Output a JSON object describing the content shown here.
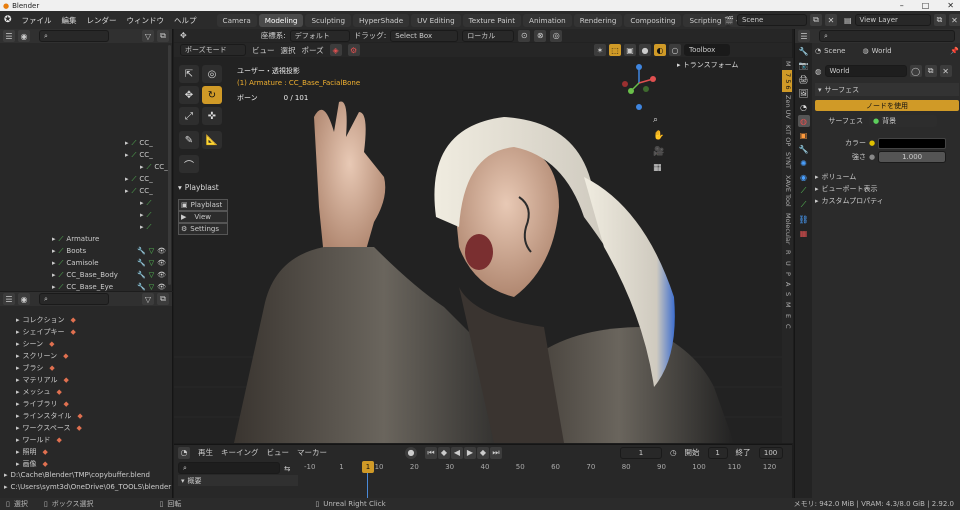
{
  "titlebar": {
    "title": "Blender",
    "min": "–",
    "max": "□",
    "close": "✕"
  },
  "menu": [
    "ファイル",
    "編集",
    "レンダー",
    "ウィンドウ",
    "ヘルプ"
  ],
  "workspaces": [
    "Camera",
    "Modeling",
    "Sculpting",
    "HyperShade",
    "UV Editing",
    "Texture Paint",
    "Animation",
    "Rendering",
    "Compositing",
    "Scripting",
    "+"
  ],
  "scene": {
    "scene_name": "Scene",
    "view_layer": "View Layer"
  },
  "viewport_header": {
    "coord_label": "座標系:",
    "coord_value": "デフォルト",
    "drag_label": "ドラッグ:",
    "drag_value": "Select Box",
    "orient_value": "ローカル",
    "mode": "ポーズモード",
    "view": "ビュー",
    "select": "選択",
    "pose": "ポーズ",
    "toolbox": "Toolbox"
  },
  "viewport_info": {
    "view_name": "ユーザー・透視投影",
    "object": "(1) Armature : CC_Base_FacialBone",
    "bones_label": "ボーン",
    "bones_value": "0 / 101",
    "transform": "トランスフォーム"
  },
  "playblast": {
    "title": "Playblast",
    "btn_playblast": "Playblast",
    "btn_view": "View",
    "btn_settings": "Settings"
  },
  "outliner": {
    "rows": [
      {
        "indent": 125,
        "label": "CC_"
      },
      {
        "indent": 125,
        "label": "CC_"
      },
      {
        "indent": 140,
        "label": "CC_"
      },
      {
        "indent": 125,
        "label": "CC_"
      },
      {
        "indent": 125,
        "label": "CC_"
      },
      {
        "indent": 140,
        "label": ""
      },
      {
        "indent": 140,
        "label": ""
      },
      {
        "indent": 140,
        "label": ""
      },
      {
        "indent": 62,
        "label": "Armature"
      },
      {
        "indent": 62,
        "label": "Boots"
      },
      {
        "indent": 62,
        "label": "Camisole"
      },
      {
        "indent": 62,
        "label": "CC_Base_Body"
      },
      {
        "indent": 62,
        "label": "CC_Base_Eye"
      }
    ]
  },
  "datablocks": [
    "コレクション",
    "シェイプキー",
    "シーン",
    "スクリーン",
    "ブラシ",
    "マテリアル",
    "メッシュ",
    "ライブラリ",
    "ラインスタイル",
    "ワークスペース",
    "ワールド",
    "照明",
    "画像"
  ],
  "libraries": [
    "D:\\Cache\\Blender\\TMP\\copybuffer.blend",
    "C:\\Users\\symt3d\\OneDrive\\06_TOOLS\\blender"
  ],
  "sidetabs": [
    "M",
    "7 5 6",
    "Zen UV",
    "KIT OP",
    "SYNT",
    "XAVE Tool",
    "Molecular",
    "R",
    "U",
    "P",
    "A",
    "S",
    "M",
    "E",
    "C"
  ],
  "props": {
    "tab_scene": "Scene",
    "tab_world": "World",
    "world_name": "World",
    "surface_panel": "サーフェス",
    "use_nodes": "ノードを使用",
    "surface_label": "サーフェス",
    "surface_value": "背景",
    "color_label": "カラー",
    "strength_label": "強さ",
    "strength_value": "1.000",
    "volume": "ボリューム",
    "viewport_display": "ビューポート表示",
    "custom_props": "カスタムプロパティ",
    "color_value": "#000000"
  },
  "timeline": {
    "play": "再生",
    "keying": "キーイング",
    "view": "ビュー",
    "marker": "マーカー",
    "current_frame": "1",
    "start_label": "開始",
    "start": "1",
    "end_label": "終了",
    "end": "100",
    "summary": "概要",
    "ticks": [
      "-10",
      "1",
      "10",
      "20",
      "30",
      "40",
      "50",
      "60",
      "70",
      "80",
      "90",
      "100",
      "110",
      "120"
    ]
  },
  "statusbar": {
    "select": "選択",
    "box_select": "ボックス選択",
    "rotate": "回転",
    "hint": "Unreal Right Click",
    "info": "メモリ: 942.0 MiB | VRAM: 4.3/8.0 GiB | 2.92.0"
  },
  "colors": {
    "accent": "#d09a27",
    "bg": "#1d1d1d",
    "panel": "#2b2b2b"
  }
}
